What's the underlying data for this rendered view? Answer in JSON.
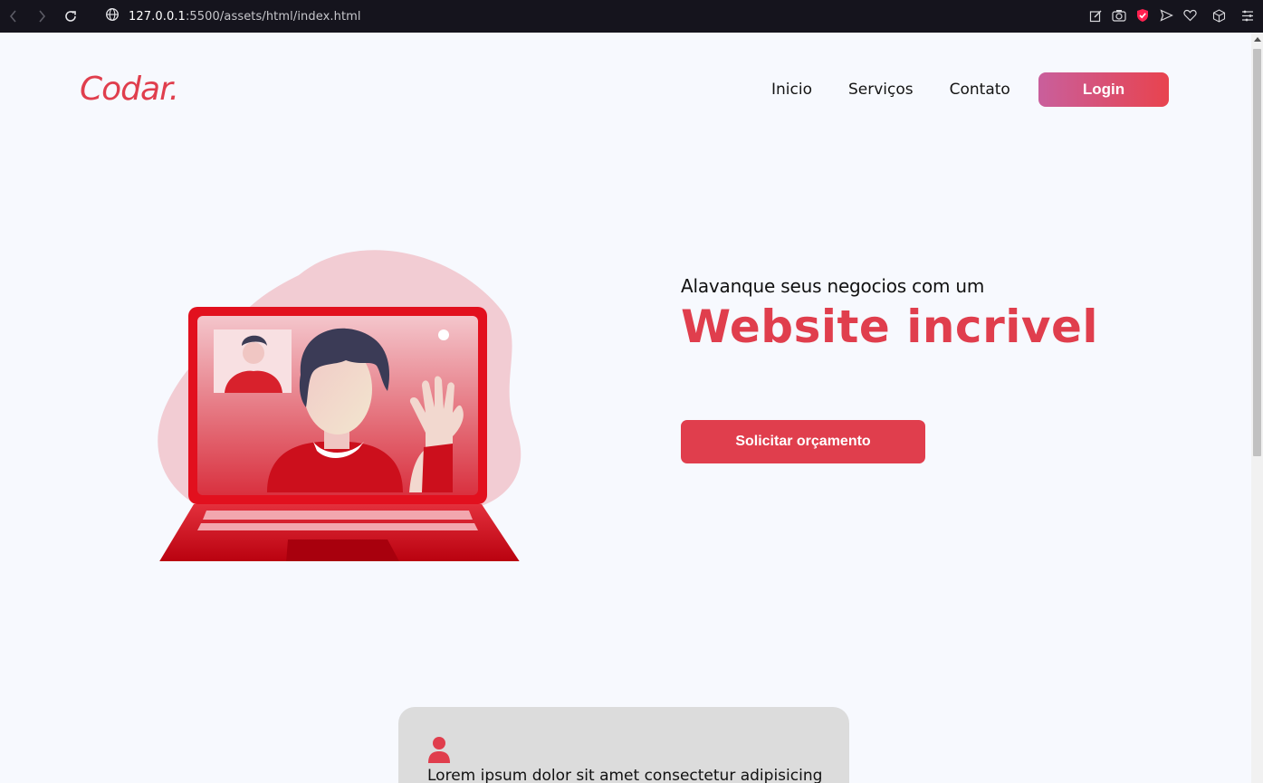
{
  "browser": {
    "url_host": "127.0.0.1",
    "url_rest": ":5500/assets/html/index.html"
  },
  "header": {
    "logo": "Codar.",
    "menu": [
      {
        "label": "Inicio"
      },
      {
        "label": "Serviços"
      },
      {
        "label": "Contato"
      }
    ],
    "login_label": "Login"
  },
  "hero": {
    "subtitle": "Alavanque seus negocios com um",
    "title": "Website incrivel",
    "cta_label": "Solicitar orçamento",
    "illustration_icon": "laptop-video-call-illustration"
  },
  "card": {
    "icon": "user-icon",
    "text": "Lorem ipsum dolor sit amet consectetur adipisicing"
  },
  "colors": {
    "brand": "#e03e4d",
    "login_gradient_start": "#c95f9c",
    "login_gradient_end": "#e8434e",
    "page_bg": "#f7f9fe",
    "card_bg": "#dcdcdc",
    "chrome_bg": "#15141d"
  }
}
